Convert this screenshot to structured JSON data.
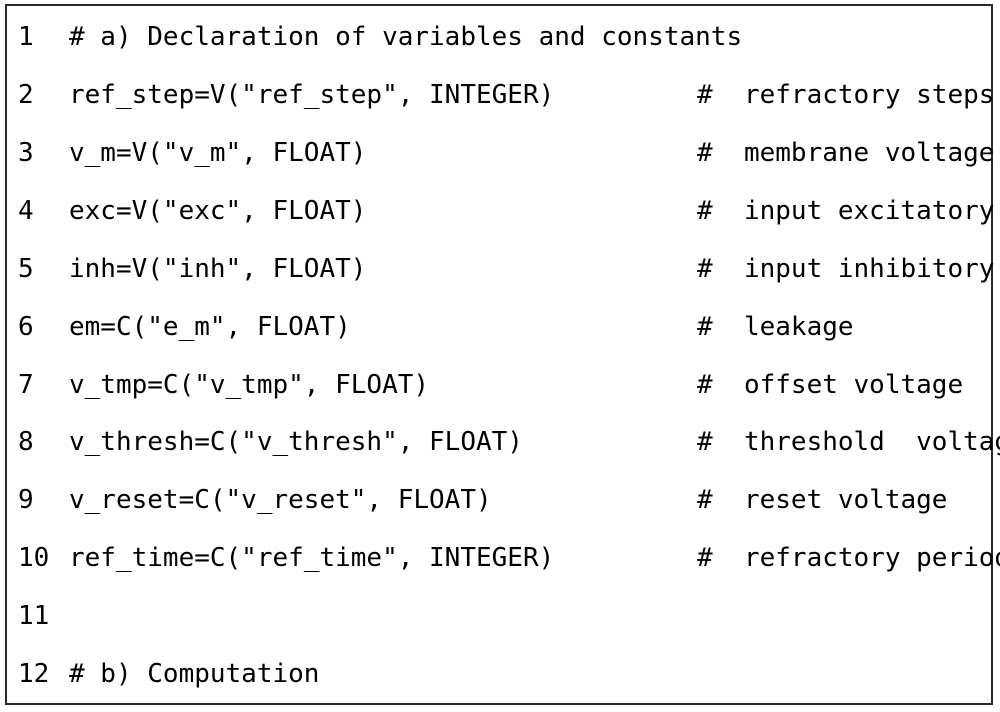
{
  "figure": {
    "name": "code-listing-figure",
    "language": "python-like",
    "border_color": "#2b2b2b",
    "background_color": "#ffffff",
    "text_color": "#000000",
    "comment_column_marker": "#"
  },
  "listing": {
    "lines": [
      {
        "number": "1",
        "code": "# a) Declaration of variables and constants",
        "comment": ""
      },
      {
        "number": "2",
        "code": "ref_step=V(\"ref_step\", INTEGER)",
        "comment": "#  refractory steps"
      },
      {
        "number": "3",
        "code": "v_m=V(\"v_m\", FLOAT)",
        "comment": "#  membrane voltage"
      },
      {
        "number": "4",
        "code": "exc=V(\"exc\", FLOAT)",
        "comment": "#  input excitatory"
      },
      {
        "number": "5",
        "code": "inh=V(\"inh\", FLOAT)",
        "comment": "#  input inhibitory"
      },
      {
        "number": "6",
        "code": "em=C(\"e_m\", FLOAT)",
        "comment": "#  leakage"
      },
      {
        "number": "7",
        "code": "v_tmp=C(\"v_tmp\", FLOAT)",
        "comment": "#  offset voltage"
      },
      {
        "number": "8",
        "code": "v_thresh=C(\"v_thresh\", FLOAT)",
        "comment": "#  threshold  voltage"
      },
      {
        "number": "9",
        "code": "v_reset=C(\"v_reset\", FLOAT)",
        "comment": "#  reset voltage"
      },
      {
        "number": "10",
        "code": "ref_time=C(\"ref_time\", INTEGER)",
        "comment": "#  refractory period"
      },
      {
        "number": "11",
        "code": "",
        "comment": ""
      },
      {
        "number": "12",
        "code": "# b) Computation",
        "comment": ""
      }
    ]
  }
}
